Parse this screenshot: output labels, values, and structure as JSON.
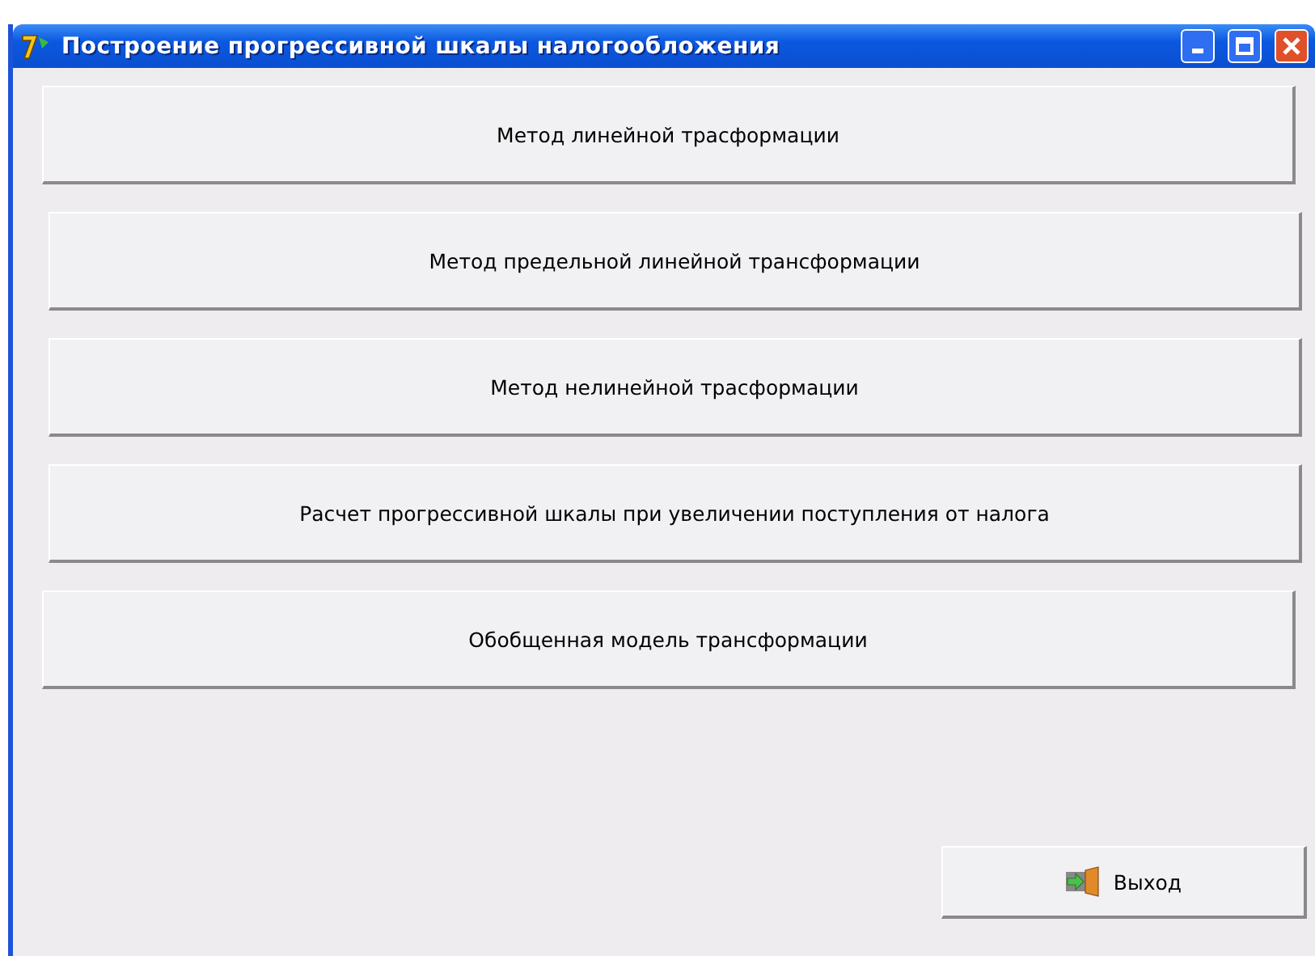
{
  "window": {
    "title": "Построение прогрессивной шкалы налогообложения"
  },
  "buttons": [
    "Метод линейной трасформации",
    "Метод предельной линейной трансформации",
    "Метод нелинейной трасформации",
    "Расчет прогрессивной шкалы при  увеличении поступления от налога",
    "Обобщенная модель трансформации"
  ],
  "exit_button": {
    "label": "Выход"
  }
}
